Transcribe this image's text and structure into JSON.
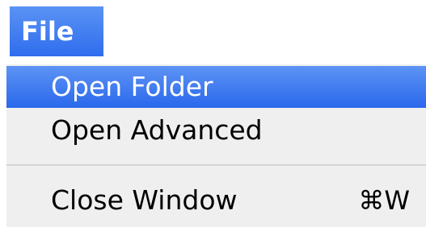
{
  "menubar": {
    "title": "File"
  },
  "menu": {
    "items": [
      {
        "label": "Open Folder",
        "highlighted": true
      },
      {
        "label": "Open Advanced",
        "highlighted": false
      },
      {
        "label": "Close Window",
        "shortcut": "⌘W",
        "highlighted": false
      }
    ]
  },
  "colors": {
    "highlight": "#3a78ef",
    "menu_background": "#efefef",
    "separator": "#d6d6d6"
  }
}
